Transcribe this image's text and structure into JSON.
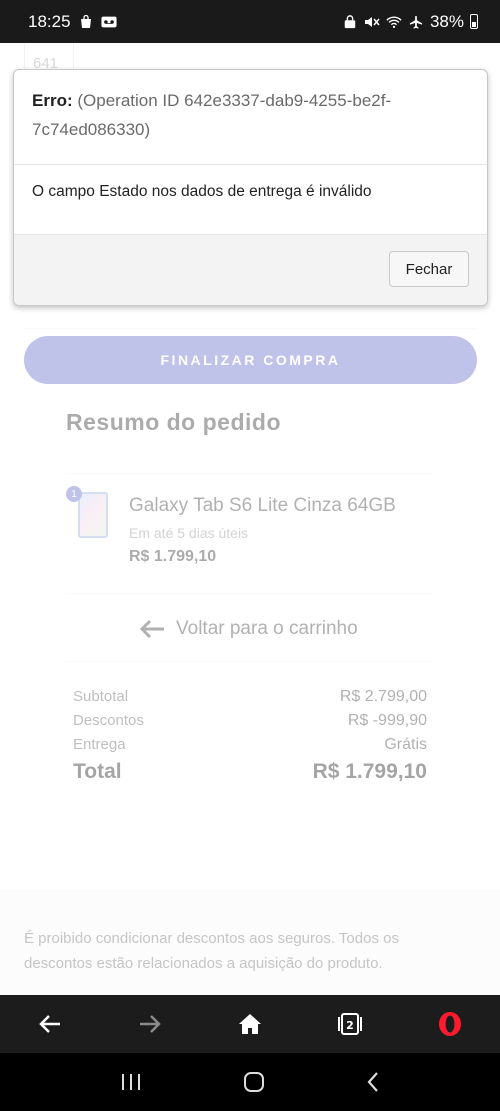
{
  "status_bar": {
    "time": "18:25",
    "battery": "38%",
    "icons_left": [
      "shopping-bag-icon",
      "voicemail-icon"
    ],
    "icons_right": [
      "lock-icon",
      "mute-icon",
      "wifi-icon",
      "airplane-icon",
      "battery-icon"
    ]
  },
  "page": {
    "partial_field_value": "641",
    "finalize_button": "FINALIZAR COMPRA",
    "summary_title": "Resumo do pedido",
    "item": {
      "quantity": "1",
      "name": "Galaxy Tab S6 Lite Cinza 64GB",
      "shipping": "Em até 5 dias úteis",
      "price": "R$ 1.799,10"
    },
    "back_link": "Voltar para o carrinho",
    "totals": [
      {
        "label": "Subtotal",
        "value": "R$ 2.799,00"
      },
      {
        "label": "Descontos",
        "value": "R$ -999,90"
      },
      {
        "label": "Entrega",
        "value": "Grátis"
      }
    ],
    "total": {
      "label": "Total",
      "value": "R$ 1.799,10"
    },
    "footer_text": "É proibido condicionar descontos aos seguros. Todos os descontos estão relacionados a aquisição do produto."
  },
  "dialog": {
    "error_label": "Erro:",
    "error_detail": "(Operation ID 642e3337-dab9-4255-be2f-7c74ed086330)",
    "message": "O campo Estado nos dados de entrega é inválido",
    "close_button": "Fechar"
  },
  "browser_bar": {
    "tab_count": "2",
    "icons": [
      "back-arrow-icon",
      "forward-arrow-icon",
      "home-icon",
      "tabs-icon",
      "opera-icon"
    ]
  },
  "colors": {
    "accent": "#5763c5",
    "opera_red": "#ff1b2d",
    "status_bar_bg": "#1a1a1a",
    "browser_bar_bg": "#1c1c1c"
  }
}
